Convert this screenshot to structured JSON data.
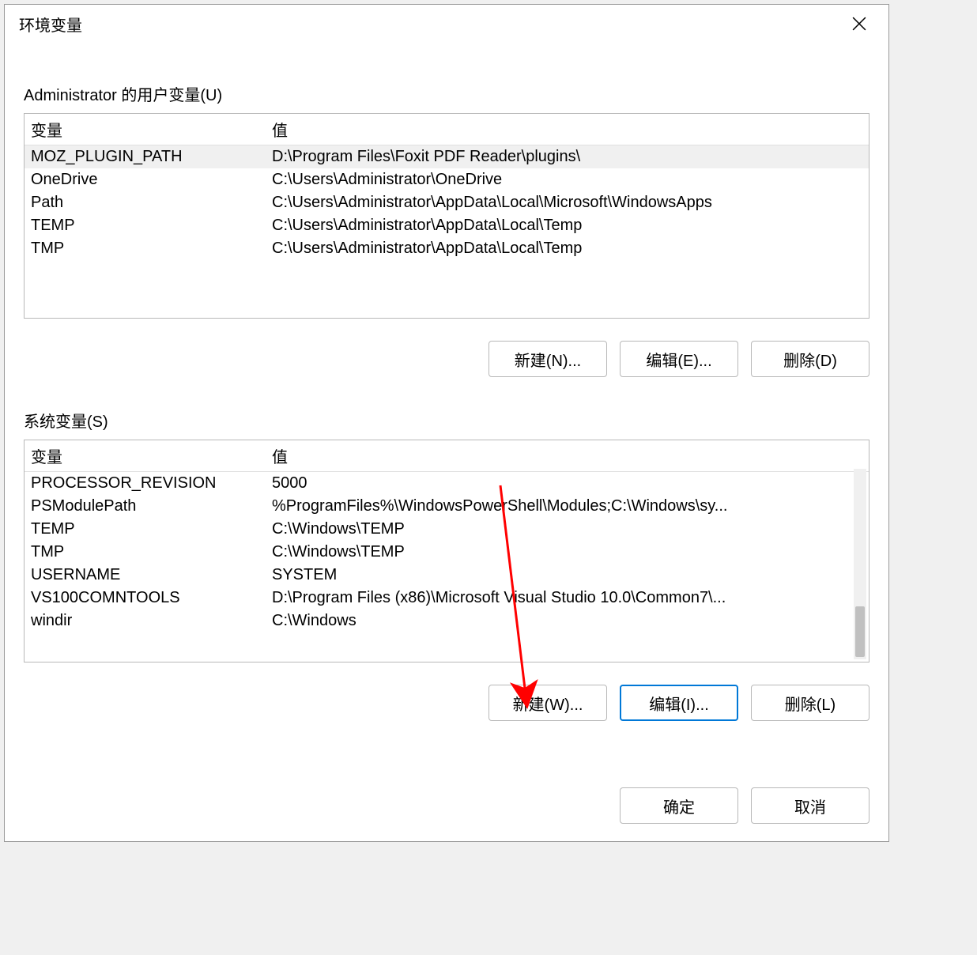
{
  "window": {
    "title": "环境变量"
  },
  "userVars": {
    "groupLabel": "Administrator 的用户变量(U)",
    "colVar": "变量",
    "colVal": "值",
    "rows": [
      {
        "name": "MOZ_PLUGIN_PATH",
        "value": "D:\\Program Files\\Foxit PDF Reader\\plugins\\"
      },
      {
        "name": "OneDrive",
        "value": "C:\\Users\\Administrator\\OneDrive"
      },
      {
        "name": "Path",
        "value": "C:\\Users\\Administrator\\AppData\\Local\\Microsoft\\WindowsApps"
      },
      {
        "name": "TEMP",
        "value": "C:\\Users\\Administrator\\AppData\\Local\\Temp"
      },
      {
        "name": "TMP",
        "value": "C:\\Users\\Administrator\\AppData\\Local\\Temp"
      }
    ],
    "selectedIndex": 0,
    "buttons": {
      "new": "新建(N)...",
      "edit": "编辑(E)...",
      "delete": "删除(D)"
    }
  },
  "sysVars": {
    "groupLabel": "系统变量(S)",
    "colVar": "变量",
    "colVal": "值",
    "rows": [
      {
        "name": "PROCESSOR_REVISION",
        "value": "5000"
      },
      {
        "name": "PSModulePath",
        "value": "%ProgramFiles%\\WindowsPowerShell\\Modules;C:\\Windows\\sy..."
      },
      {
        "name": "TEMP",
        "value": "C:\\Windows\\TEMP"
      },
      {
        "name": "TMP",
        "value": "C:\\Windows\\TEMP"
      },
      {
        "name": "USERNAME",
        "value": "SYSTEM"
      },
      {
        "name": "VS100COMNTOOLS",
        "value": "D:\\Program Files (x86)\\Microsoft Visual Studio 10.0\\Common7\\..."
      },
      {
        "name": "windir",
        "value": "C:\\Windows"
      }
    ],
    "buttons": {
      "new": "新建(W)...",
      "edit": "编辑(I)...",
      "delete": "删除(L)"
    }
  },
  "dialogButtons": {
    "ok": "确定",
    "cancel": "取消"
  },
  "annotations": {
    "arrowColor": "#ff0000"
  }
}
